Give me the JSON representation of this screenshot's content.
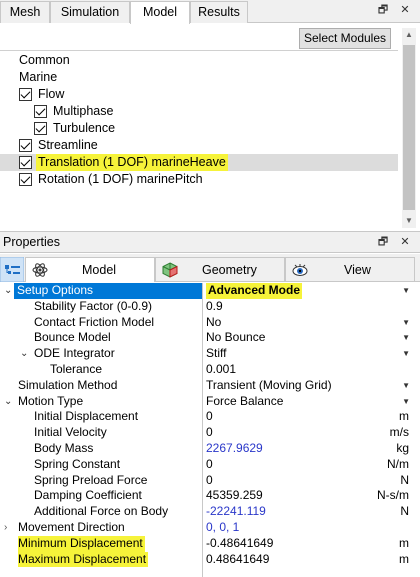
{
  "top_tabs": [
    "Mesh",
    "Simulation",
    "Model",
    "Results"
  ],
  "window_buttons": {
    "restore": "🗗",
    "close": "✕"
  },
  "select_modules_label": "Select Modules",
  "tree": {
    "common": "Common",
    "marine": "Marine",
    "flow": "Flow",
    "multiphase": "Multiphase",
    "turbulence": "Turbulence",
    "streamline": "Streamline",
    "translation": "Translation (1 DOF) marineHeave",
    "rotation": "Rotation (1 DOF) marinePitch"
  },
  "properties_title": "Properties",
  "property_tabs": [
    "Model",
    "Geometry",
    "View"
  ],
  "rows": {
    "setup_options": {
      "name": "Setup Options",
      "value": "Advanced Mode"
    },
    "stability_factor": {
      "name": "Stability Factor (0-0.9)",
      "value": "0.9"
    },
    "contact_friction": {
      "name": "Contact Friction Model",
      "value": "No"
    },
    "bounce_model": {
      "name": "Bounce Model",
      "value": "No Bounce"
    },
    "ode_integrator": {
      "name": "ODE Integrator",
      "value": "Stiff"
    },
    "tolerance": {
      "name": "Tolerance",
      "value": "0.001"
    },
    "simulation_method": {
      "name": "Simulation Method",
      "value": "Transient (Moving Grid)"
    },
    "motion_type": {
      "name": "Motion Type",
      "value": "Force Balance"
    },
    "initial_displacement": {
      "name": "Initial Displacement",
      "value": "0",
      "unit": "m"
    },
    "initial_velocity": {
      "name": "Initial Velocity",
      "value": "0",
      "unit": "m/s"
    },
    "body_mass": {
      "name": "Body Mass",
      "value": "2267.9629",
      "unit": "kg"
    },
    "spring_constant": {
      "name": "Spring Constant",
      "value": "0",
      "unit": "N/m"
    },
    "spring_preload": {
      "name": "Spring Preload Force",
      "value": "0",
      "unit": "N"
    },
    "damping_coefficient": {
      "name": "Damping Coefficient",
      "value": "45359.259",
      "unit": "N-s/m"
    },
    "additional_force": {
      "name": "Additional Force on Body",
      "value": "-22241.119",
      "unit": "N"
    },
    "movement_direction": {
      "name": "Movement Direction",
      "value": "0, 0, 1"
    },
    "min_displacement": {
      "name": "Minimum Displacement",
      "value": "-0.48641649",
      "unit": "m"
    },
    "max_displacement": {
      "name": "Maximum Displacement",
      "value": "0.48641649",
      "unit": "m"
    }
  },
  "colors": {
    "selection": "#0078d7",
    "highlight": "#f6f33a",
    "link_value": "#2a37c9"
  }
}
